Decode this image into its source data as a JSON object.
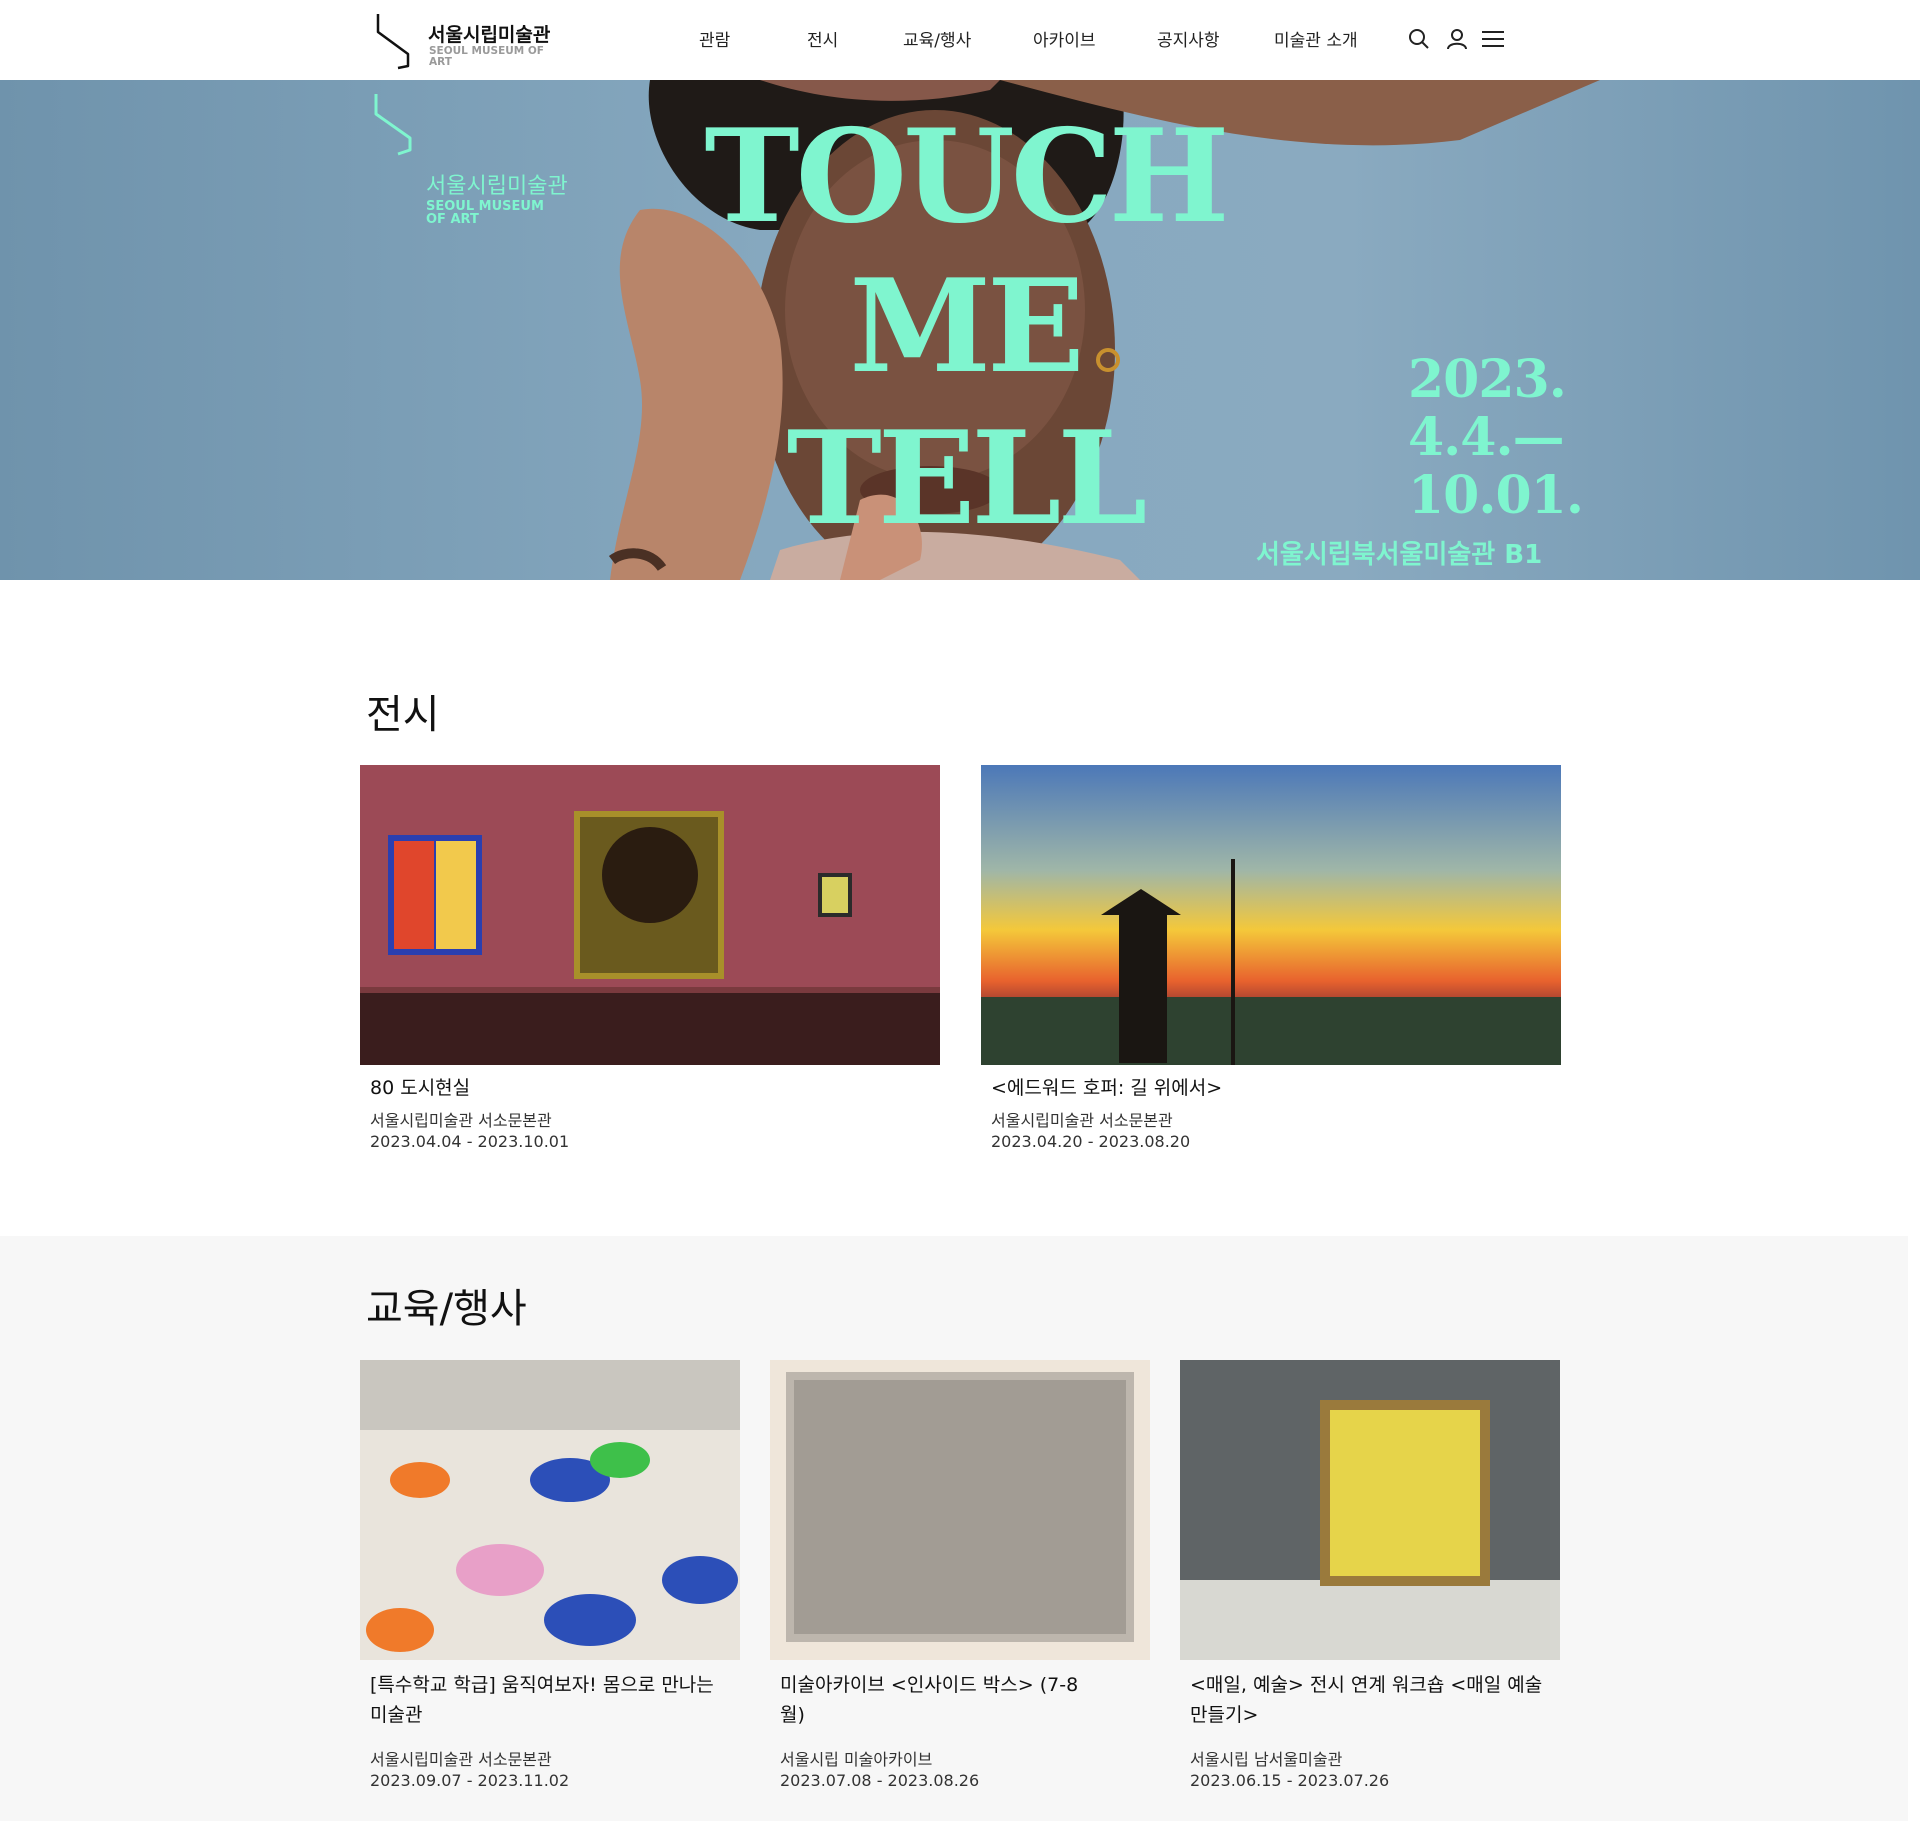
{
  "header": {
    "logo_ko": "서울시립미술관",
    "logo_en": "SEOUL MUSEUM OF ART",
    "nav": [
      "관람",
      "전시",
      "교육/행사",
      "아카이브",
      "공지사항",
      "미술관 소개"
    ],
    "icons": [
      "search-icon",
      "user-icon",
      "menu-icon"
    ]
  },
  "hero": {
    "logo_ko": "서울시립미술관",
    "logo_en": "SEOUL MUSEUM OF ART",
    "title_line1": "TOUCH",
    "title_line2": "ME",
    "title_line3": "TELL",
    "date_line1": "2023.",
    "date_line2": "4.4.—",
    "date_line3": "10.01.",
    "venue": "서울시립북서울미술관 B1",
    "accent_color": "#7ff5cf"
  },
  "exhibitions": {
    "heading": "전시",
    "items": [
      {
        "title": "80 도시현실",
        "venue": "서울시립미술관 서소문본관",
        "period": "2023.04.04 - 2023.10.01"
      },
      {
        "title": "<에드워드 호퍼: 길 위에서>",
        "venue": "서울시립미술관 서소문본관",
        "period": "2023.04.20 - 2023.08.20"
      }
    ]
  },
  "education": {
    "heading": "교육/행사",
    "items": [
      {
        "title": "[특수학교 학급] 움직여보자! 몸으로 만나는 미술관",
        "venue": "서울시립미술관 서소문본관",
        "period": "2023.09.07 - 2023.11.02"
      },
      {
        "title": "미술아카이브 <인사이드 박스> (7-8월)",
        "venue": "서울시립 미술아카이브",
        "period": "2023.07.08 - 2023.08.26"
      },
      {
        "title": "<매일, 예술> 전시 연계 워크숍 <매일 예술 만들기>",
        "venue": "서울시립 남서울미술관",
        "period": "2023.06.15 - 2023.07.26"
      }
    ]
  }
}
